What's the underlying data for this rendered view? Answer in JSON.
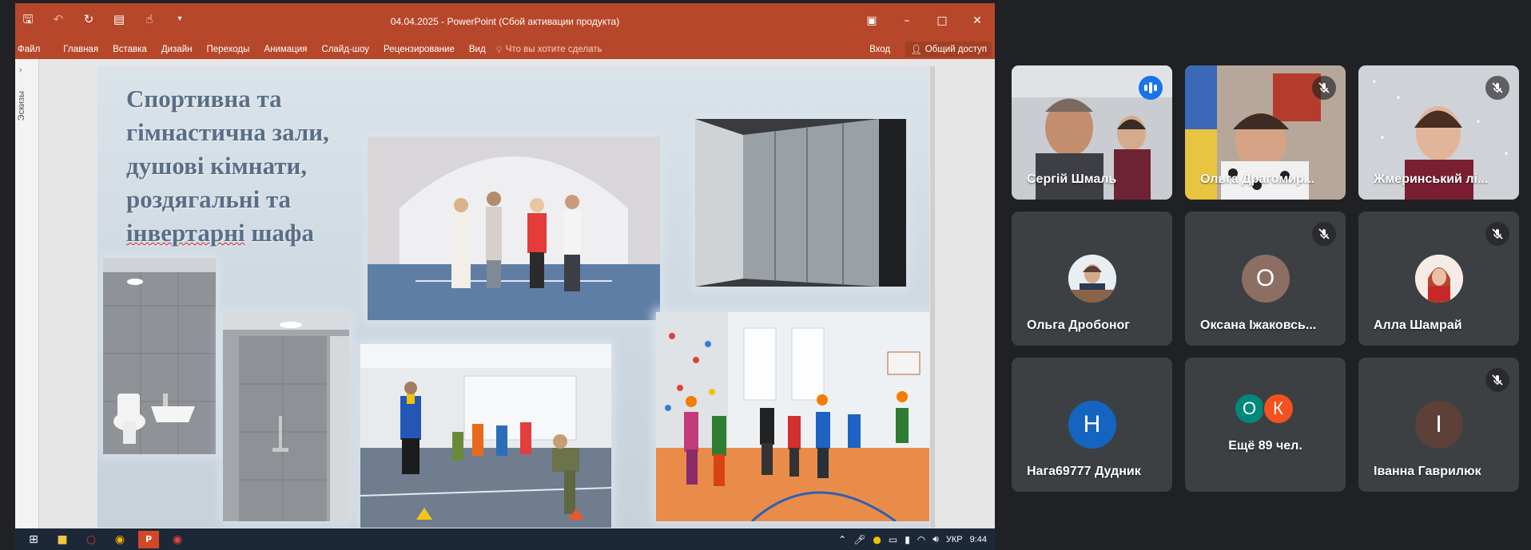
{
  "powerpoint": {
    "window_title": "04.04.2025 - PowerPoint (Сбой активации продукта)",
    "ribbon_tabs": [
      "Файл",
      "Главная",
      "Вставка",
      "Дизайн",
      "Переходы",
      "Анимация",
      "Слайд-шоу",
      "Рецензирование",
      "Вид"
    ],
    "tell_me": "Что вы хотите сделать",
    "sign_in": "Вход",
    "share": "Общий доступ",
    "thumbnails_label": "Эскизы",
    "slide": {
      "title_line1": "Спортивна та",
      "title_line2": "гімнастична зали,",
      "title_line3": "душові кімнати,",
      "title_line4": "роздягальні та",
      "title_word_misspelled": "інвертарні",
      "title_word_last": "шафа"
    },
    "taskbar": {
      "language": "УКР",
      "clock": "9:44"
    }
  },
  "participants": [
    {
      "name": "Сергій Шмаль",
      "status": "speaking"
    },
    {
      "name": "Ольга Драгомир...",
      "status": "muted"
    },
    {
      "name": "Жмеринський лі...",
      "status": "muted"
    },
    {
      "name": "Ольга Дробоног",
      "status": "unmuted"
    },
    {
      "name": "Оксана Іжаковсь...",
      "avatar_letter": "О",
      "avatar_color": "#8d6e63",
      "status": "muted"
    },
    {
      "name": "Алла Шамрай",
      "status": "muted"
    },
    {
      "name": "Нага69777 Дудник",
      "avatar_letter": "Н",
      "avatar_color": "#1565c0",
      "status": "unmuted"
    },
    {
      "name": "Ещё 89 чел.",
      "avatar_letters": [
        "О",
        "К"
      ],
      "avatar_colors": [
        "#00897b",
        "#f4511e"
      ]
    },
    {
      "name": "Іванна Гаврилюк",
      "avatar_letter": "І",
      "avatar_color": "#5d4037",
      "status": "muted"
    }
  ],
  "colors": {
    "meet_background": "#202124",
    "tile_background": "#3c4043",
    "ppt_accent": "#b7472a",
    "active_speaker_outline": "#8ab4f8"
  }
}
